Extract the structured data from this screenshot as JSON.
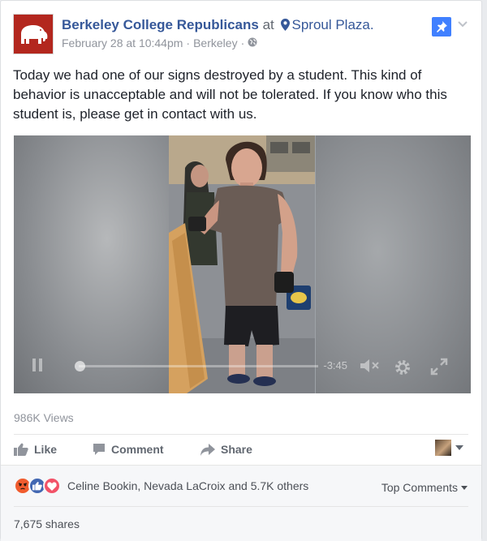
{
  "post": {
    "page_name": "Berkeley College Republicans",
    "at_word": "at",
    "place": "Sproul Plaza.",
    "date": "February 28 at 10:44pm",
    "separator": "·",
    "location": "Berkeley",
    "text": "Today we had one of our signs destroyed by a student. This kind of behavior is unacceptable and will not be tolerated. If you know who this student is, please get in contact with us."
  },
  "video": {
    "duration": "-3:45",
    "progress": 0.0
  },
  "stats": {
    "views": "986K Views"
  },
  "actions": {
    "like_label": "Like",
    "comment_label": "Comment",
    "share_label": "Share"
  },
  "reactions": {
    "names": "Celine Bookin, Nevada LaCroix and 5.7K others",
    "top_comments": "Top Comments",
    "shares": "7,675 shares"
  },
  "colors": {
    "brand_red": "#b3271e",
    "link_blue": "#365899",
    "pin_blue": "#4080ff",
    "angry": "#f05c2e",
    "like": "#4267b2",
    "love": "#f25268"
  }
}
